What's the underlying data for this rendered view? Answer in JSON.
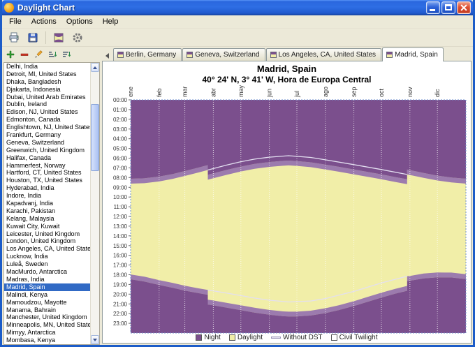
{
  "window": {
    "title": "Daylight Chart"
  },
  "menu": {
    "items": [
      "File",
      "Actions",
      "Options",
      "Help"
    ]
  },
  "toolbar": {
    "icons": [
      "print-icon",
      "save-icon",
      "chart-icon",
      "options-icon"
    ]
  },
  "locations_panel": {
    "toolbar_icons": [
      "add-location-icon",
      "remove-location-icon",
      "edit-location-icon",
      "sort-ascending-icon",
      "sort-descending-icon"
    ],
    "selected_city": "Madrid, Spain",
    "selection_color": "#316AC5",
    "cities": [
      "Delhi, India",
      "Detroit, MI, United States",
      "Dhaka, Bangladesh",
      "Djakarta, Indonesia",
      "Dubai, United Arab Emirates",
      "Dublin, Ireland",
      "Edison, NJ, United States",
      "Edmonton, Canada",
      "Englishtown, NJ, United States",
      "Frankfurt, Germany",
      "Geneva, Switzerland",
      "Greenwich, United Kingdom",
      "Halifax, Canada",
      "Hammerfest, Norway",
      "Hartford, CT, United States",
      "Houston, TX, United States",
      "Hyderabad, India",
      "Indore, India",
      "Kapadvanj, India",
      "Karachi, Pakistan",
      "Kelang, Malaysia",
      "Kuwait City, Kuwait",
      "Leicester, United Kingdom",
      "London, United Kingdom",
      "Los Angeles, CA, United States",
      "Lucknow, India",
      "Luleå, Sweden",
      "MacMurdo, Antarctica",
      "Madras, India",
      "Madrid, Spain",
      "Malindi, Kenya",
      "Mamoudzou, Mayotte",
      "Manama, Bahrain",
      "Manchester, United Kingdom",
      "Minneapolis, MN, United States",
      "Mirnyy, Antarctica",
      "Mombasa, Kenya"
    ]
  },
  "tabs": {
    "active_index": 3,
    "items": [
      "Berlin, Germany",
      "Geneva, Switzerland",
      "Los Angeles, CA, United States",
      "Madrid, Spain"
    ]
  },
  "chart_data": {
    "type": "area",
    "title": "Madrid, Spain",
    "subtitle": "40° 24' N, 3° 41' W, Hora de Europa Central",
    "x_axis": {
      "position": "top",
      "tick_labels": [
        "ene",
        "feb",
        "mar",
        "abr",
        "may",
        "jun",
        "jul",
        "ago",
        "sep",
        "oct",
        "nov",
        "dic"
      ],
      "tick_days": [
        0,
        31,
        59,
        90,
        120,
        151,
        181,
        212,
        243,
        273,
        304,
        334
      ],
      "range_days": [
        0,
        365
      ]
    },
    "y_axis": {
      "tick_labels": [
        "00:00",
        "01:00",
        "02:00",
        "03:00",
        "04:00",
        "05:00",
        "06:00",
        "07:00",
        "08:00",
        "09:00",
        "10:00",
        "11:00",
        "12:00",
        "13:00",
        "14:00",
        "15:00",
        "16:00",
        "17:00",
        "18:00",
        "19:00",
        "20:00",
        "21:00",
        "22:00",
        "23:00"
      ],
      "range_hours": [
        0,
        24
      ],
      "direction": "down"
    },
    "twilight_offset_hours": 0.5,
    "series": [
      {
        "name": "sunrise",
        "points": [
          [
            0,
            8.62
          ],
          [
            15,
            8.58
          ],
          [
            31,
            8.4
          ],
          [
            46,
            8.13
          ],
          [
            59,
            7.83
          ],
          [
            74,
            7.47
          ],
          [
            84,
            7.22
          ],
          [
            84,
            8.22
          ],
          [
            90,
            8.07
          ],
          [
            105,
            7.7
          ],
          [
            120,
            7.37
          ],
          [
            135,
            7.1
          ],
          [
            151,
            6.9
          ],
          [
            166,
            6.78
          ],
          [
            172,
            6.75
          ],
          [
            181,
            6.8
          ],
          [
            196,
            6.93
          ],
          [
            212,
            7.17
          ],
          [
            227,
            7.4
          ],
          [
            243,
            7.67
          ],
          [
            258,
            7.92
          ],
          [
            273,
            8.17
          ],
          [
            288,
            8.45
          ],
          [
            301,
            8.68
          ],
          [
            301,
            7.68
          ],
          [
            304,
            7.73
          ],
          [
            319,
            8.03
          ],
          [
            334,
            8.3
          ],
          [
            349,
            8.5
          ],
          [
            365,
            8.62
          ]
        ]
      },
      {
        "name": "sunset",
        "points": [
          [
            0,
            17.97
          ],
          [
            15,
            18.2
          ],
          [
            31,
            18.55
          ],
          [
            46,
            18.85
          ],
          [
            59,
            19.13
          ],
          [
            74,
            19.4
          ],
          [
            84,
            19.57
          ],
          [
            84,
            20.57
          ],
          [
            90,
            20.65
          ],
          [
            105,
            20.9
          ],
          [
            120,
            21.15
          ],
          [
            135,
            21.4
          ],
          [
            151,
            21.62
          ],
          [
            166,
            21.77
          ],
          [
            172,
            21.8
          ],
          [
            181,
            21.8
          ],
          [
            196,
            21.7
          ],
          [
            212,
            21.45
          ],
          [
            227,
            21.13
          ],
          [
            243,
            20.72
          ],
          [
            258,
            20.28
          ],
          [
            273,
            19.85
          ],
          [
            288,
            19.45
          ],
          [
            301,
            19.15
          ],
          [
            301,
            18.15
          ],
          [
            304,
            18.12
          ],
          [
            319,
            17.88
          ],
          [
            334,
            17.77
          ],
          [
            349,
            17.78
          ],
          [
            365,
            17.95
          ]
        ]
      },
      {
        "name": "without_dst_sunrise",
        "points": [
          [
            84,
            7.22
          ],
          [
            105,
            6.7
          ],
          [
            120,
            6.37
          ],
          [
            135,
            6.1
          ],
          [
            151,
            5.9
          ],
          [
            172,
            5.75
          ],
          [
            196,
            5.93
          ],
          [
            212,
            6.17
          ],
          [
            243,
            6.67
          ],
          [
            273,
            7.17
          ],
          [
            301,
            7.68
          ]
        ]
      },
      {
        "name": "without_dst_sunset",
        "points": [
          [
            84,
            19.57
          ],
          [
            105,
            19.9
          ],
          [
            120,
            20.15
          ],
          [
            135,
            20.4
          ],
          [
            151,
            20.62
          ],
          [
            172,
            20.8
          ],
          [
            196,
            20.7
          ],
          [
            212,
            20.45
          ],
          [
            243,
            19.72
          ],
          [
            273,
            18.85
          ],
          [
            301,
            18.15
          ]
        ]
      }
    ],
    "colors": {
      "night": "#7b4f8d",
      "twilight": "#9c7bae",
      "daylight": "#f1eea8",
      "without_dst_line": "#e3dff0",
      "grid": "#ffffff",
      "plot_border": "#7090d0"
    },
    "legend": [
      {
        "label": "Night",
        "type": "box",
        "color": "#7b4f8d"
      },
      {
        "label": "Daylight",
        "type": "box",
        "color": "#f1eea8"
      },
      {
        "label": "Without DST",
        "type": "line",
        "color": "#e3dff0"
      },
      {
        "label": "Civil Twilight",
        "type": "box",
        "color": "#ffffff"
      }
    ]
  }
}
